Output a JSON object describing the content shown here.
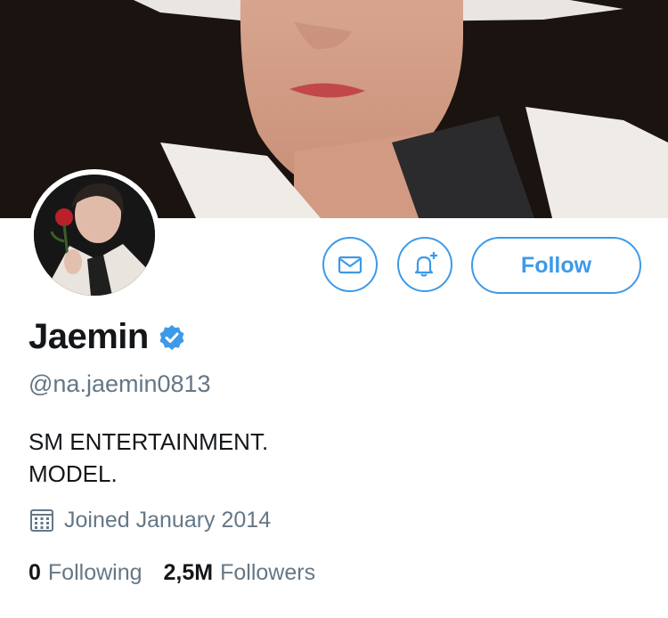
{
  "profile": {
    "display_name": "Jaemin",
    "handle": "@na.jaemin0813",
    "bio_lines": [
      "SM ENTERTAINMENT.",
      "MODEL."
    ],
    "joined": "Joined January 2014",
    "verified": true
  },
  "actions": {
    "follow_label": "Follow",
    "message_icon": "envelope-icon",
    "notify_icon": "bell-plus-icon"
  },
  "stats": {
    "following_count": "0",
    "following_label": "Following",
    "followers_count": "2,5M",
    "followers_label": "Followers"
  },
  "colors": {
    "accent": "#3d9ae8",
    "text_primary": "#14171a",
    "text_secondary": "#657786",
    "verified_badge": "#3d9ae8"
  }
}
